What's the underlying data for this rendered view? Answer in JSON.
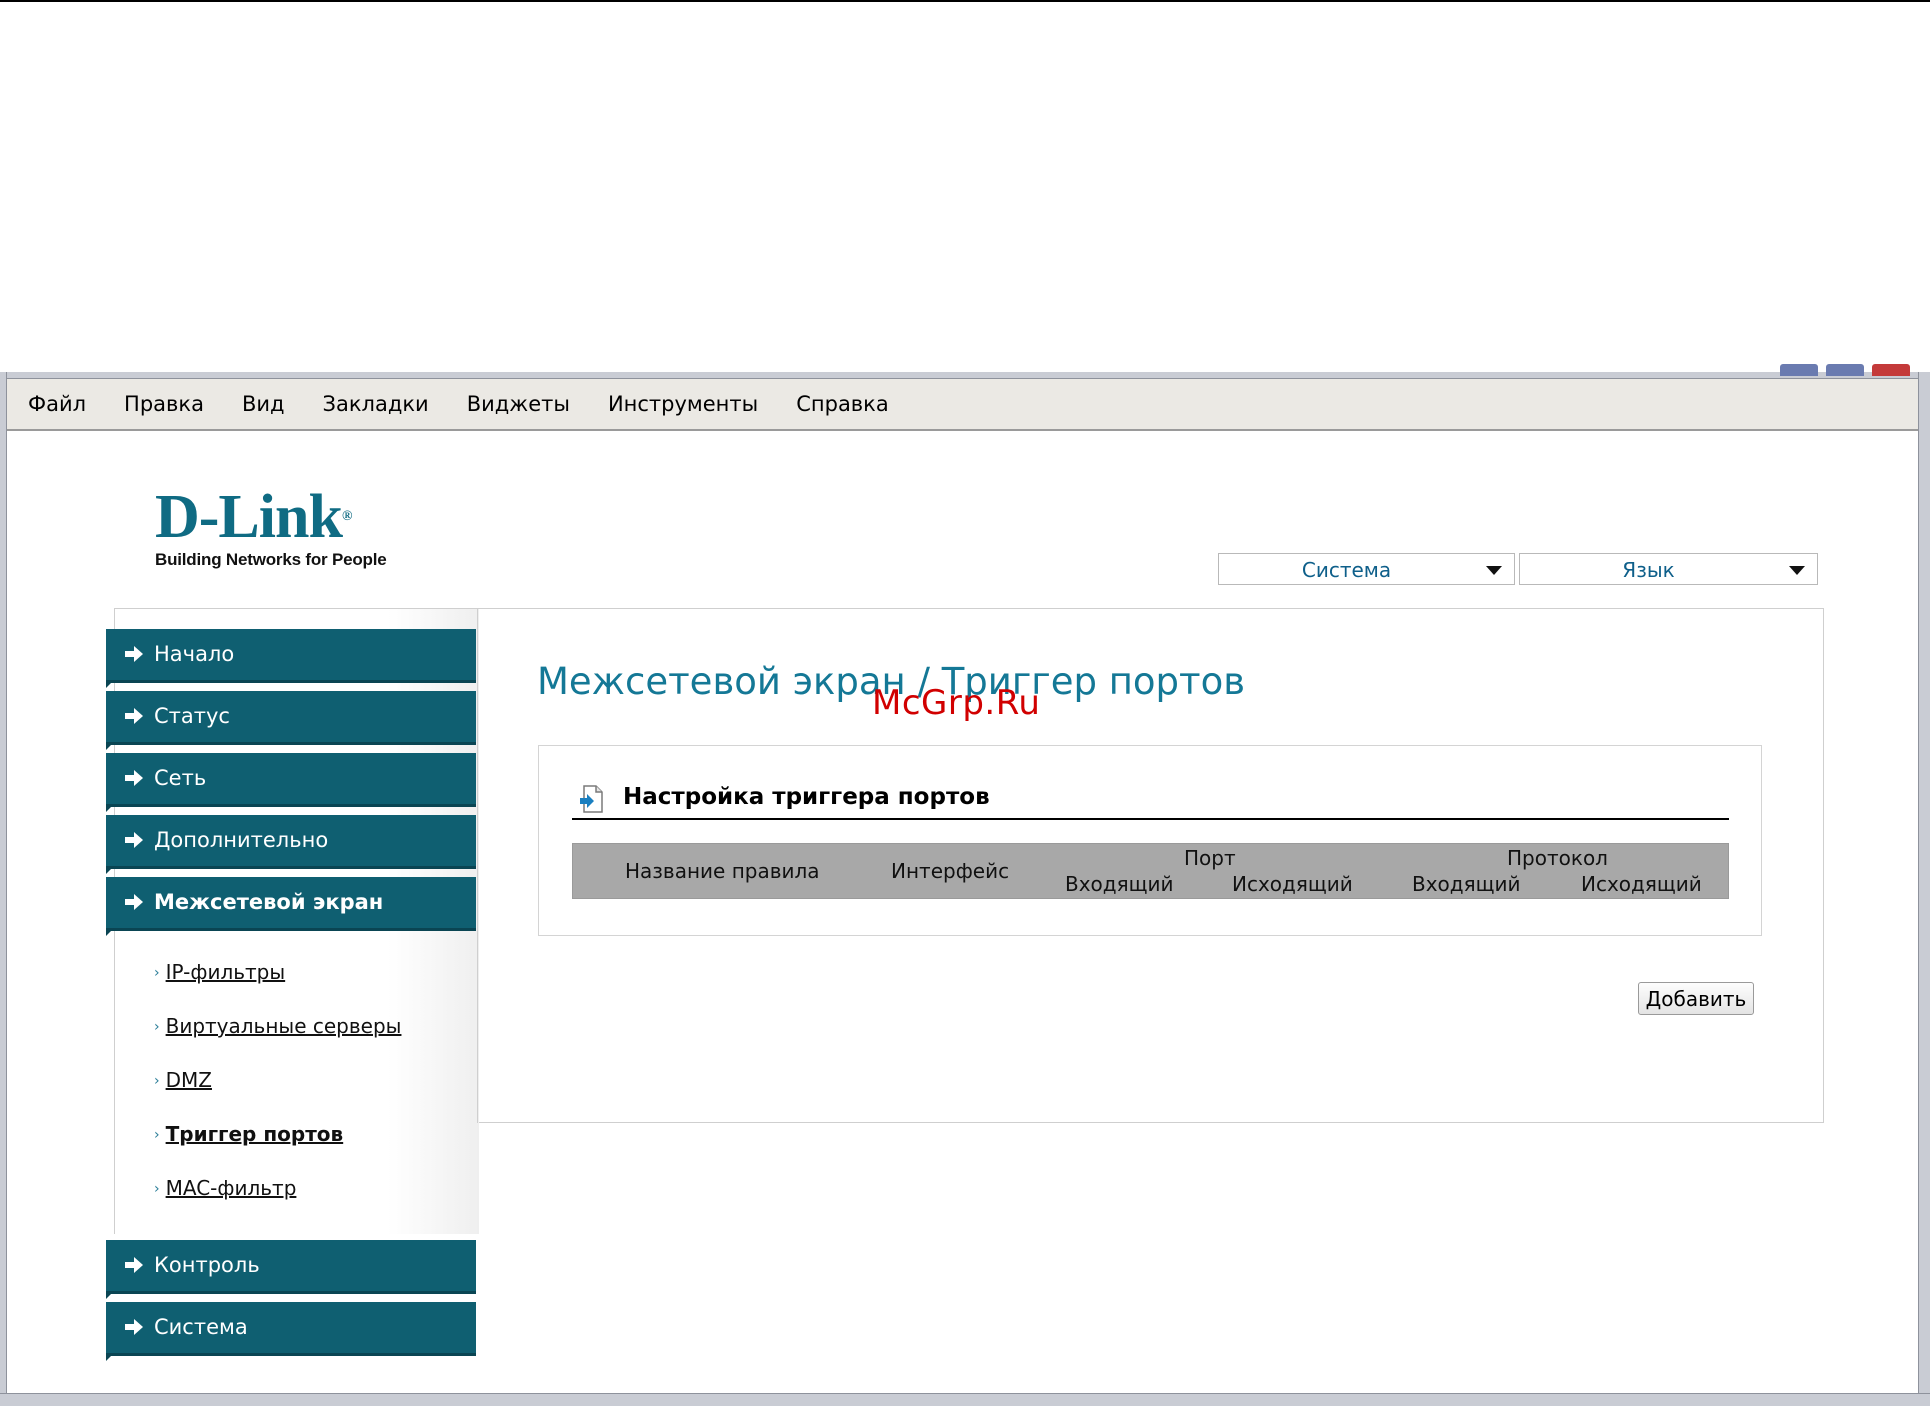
{
  "menubar": {
    "items": [
      "Файл",
      "Правка",
      "Вид",
      "Закладки",
      "Виджеты",
      "Инструменты",
      "Справка"
    ]
  },
  "logo": {
    "brand": "D-Link",
    "registered": "®",
    "tagline": "Building Networks for People"
  },
  "header": {
    "system_select": "Система",
    "language_select": "Язык"
  },
  "sidebar": {
    "items": [
      "Начало",
      "Статус",
      "Сеть",
      "Дополнительно",
      "Межсетевой экран",
      "Контроль",
      "Система"
    ],
    "submenu": [
      "IP-фильтры",
      "Виртуальные серверы",
      "DMZ",
      "Триггер портов",
      "MAC-фильтр"
    ]
  },
  "main": {
    "page_title": "Межсетевой экран / Триггер портов",
    "watermark": "McGrp.Ru",
    "section_title": "Настройка триггера портов",
    "table": {
      "col_rule_name": "Название правила",
      "col_interface": "Интерфейс",
      "group_port": "Порт",
      "group_protocol": "Протокол",
      "port_in": "Входящий",
      "port_out": "Исходящий",
      "proto_in": "Входящий",
      "proto_out": "Исходящий"
    },
    "add_button": "Добавить"
  },
  "colors": {
    "nav_bg": "#0f5f71",
    "title_color": "#147896",
    "brand": "#0f6b83",
    "watermark": "#d10000"
  },
  "icons": {
    "nav_arrow": "arrow-right-icon",
    "section": "document-arrow-icon",
    "select": "chevron-down-icon"
  }
}
